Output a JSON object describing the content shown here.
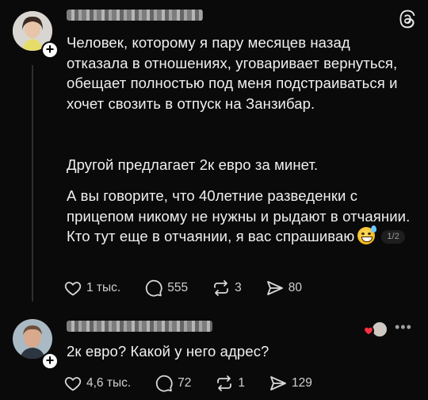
{
  "post1": {
    "paragraphs": [
      "Человек, которому я пару месяцев назад отказала в отношениях, уговаривает вернуться, обещает полностью под меня подстраиваться и хочет свозить в отпуск на Занзибар.",
      "Другой предлагает 2к евро за минет.",
      "А вы говорите, что 40летние разведенки с прицепом никому не нужны и рыдают в отчаянии. Кто тут еще в отчаянии, я вас спрашиваю"
    ],
    "page_indicator": "1/2",
    "likes": "1 тыс.",
    "comments": "555",
    "reposts": "3",
    "shares": "80"
  },
  "post2": {
    "text": "2к евро? Какой у него адрес?",
    "likes": "4,6 тыс.",
    "comments": "72",
    "reposts": "1",
    "shares": "129"
  },
  "icons": {
    "threads": "threads-logo-icon",
    "like": "heart-outline-icon",
    "comment": "speech-bubble-icon",
    "repost": "repost-arrows-icon",
    "share": "send-arrow-icon",
    "follow": "plus-icon",
    "more": "more-dots-icon"
  },
  "colors": {
    "background": "#0a0a0a",
    "text": "#f0f0f0",
    "muted": "#d0d0d0",
    "like_badge": "#ff3040"
  }
}
